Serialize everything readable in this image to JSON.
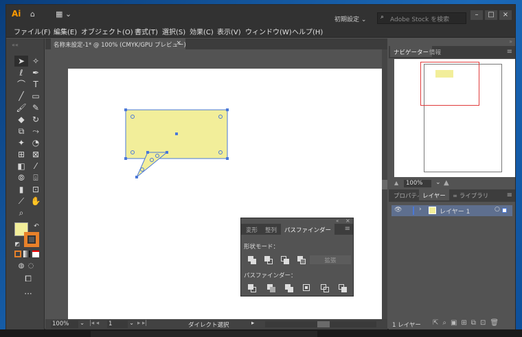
{
  "app": {
    "logo": "Ai",
    "preset": "初期設定",
    "stock_placeholder": "Adobe Stock を検索",
    "title_window_controls": [
      "–",
      "□",
      "×"
    ]
  },
  "menu": [
    "ファイル(F)",
    "編集(E)",
    "オブジェクト(O)",
    "書式(T)",
    "選択(S)",
    "効果(C)",
    "表示(V)",
    "ウィンドウ(W)",
    "ヘルプ(H)"
  ],
  "document": {
    "tab_title": "名称未設定-1* @ 100% (CMYK/GPU プレビュー)",
    "close": "×"
  },
  "status": {
    "zoom": "100%",
    "page": "1",
    "tool": "ダイレクト選択"
  },
  "navigator": {
    "tabs": [
      "ナビゲーター",
      "情報"
    ],
    "zoom": "100%"
  },
  "layers": {
    "tabs": [
      "プロパティ",
      "レイヤー",
      "ライブラリ"
    ],
    "layer_name": "レイヤー 1",
    "count": "1 レイヤー"
  },
  "pathfinder": {
    "tabs": [
      "変形",
      "整列",
      "パスファインダー"
    ],
    "shape_modes": "形状モード：",
    "expand": "拡張",
    "pathfinders": "パスファインダー："
  },
  "colors": {
    "shape_fill": "#f2ee9a",
    "selection": "#4a78d8",
    "panel_bg": "#535353"
  }
}
